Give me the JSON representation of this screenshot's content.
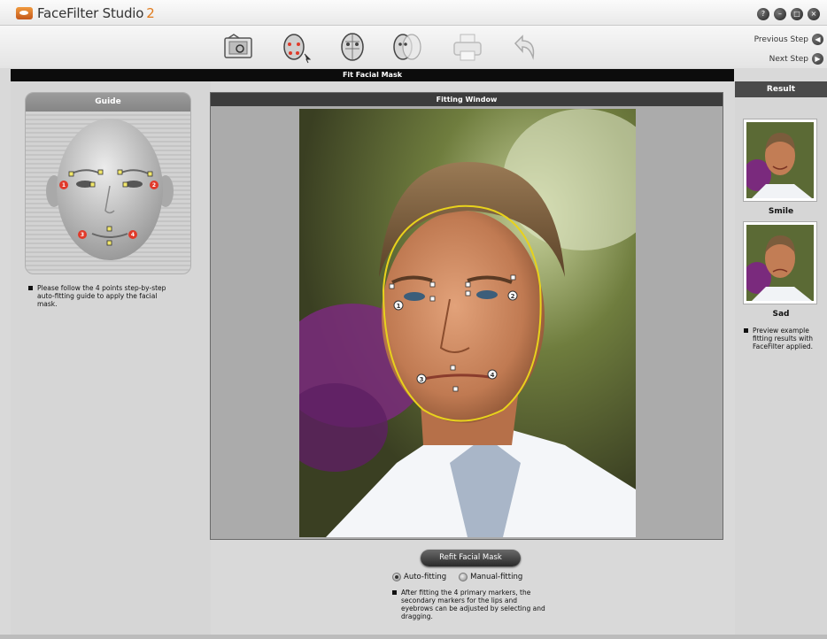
{
  "app": {
    "title": "FaceFilter Studio",
    "version": "2",
    "window_buttons": [
      "help-icon",
      "minimize-icon",
      "restore-icon",
      "close-icon"
    ]
  },
  "toolbar": {
    "steps": [
      "open-photo-icon",
      "fit-facial-mask-icon",
      "edit-face-icon",
      "compare-faces-icon",
      "print-icon",
      "undo-icon"
    ],
    "active_step": 1,
    "previous_step_label": "Previous Step",
    "next_step_label": "Next Step"
  },
  "section_title": "Fit Facial Mask",
  "guide": {
    "title": "Guide",
    "instruction": "Please follow the 4 points step-by-step auto-fitting guide to apply the facial mask.",
    "markers": [
      "1",
      "2",
      "3",
      "4"
    ]
  },
  "fitting_window": {
    "title": "Fitting Window",
    "markers": [
      "1",
      "2",
      "3",
      "4"
    ]
  },
  "controls": {
    "refit_button": "Refit Facial Mask",
    "auto_fitting_label": "Auto-fitting",
    "manual_fitting_label": "Manual-fitting",
    "selected_mode": "Auto-fitting",
    "note": "After fitting the 4 primary markers, the secondary markers for the lips and eyebrows can be adjusted by selecting and dragging."
  },
  "result": {
    "title": "Result",
    "previews": [
      {
        "label": "Smile"
      },
      {
        "label": "Sad"
      }
    ],
    "note": "Preview example fitting results with FaceFilter applied."
  },
  "colors": {
    "mask_outline": "#e8d21c",
    "marker_red": "#e03a2a",
    "marker_white": "#ffffff",
    "accent_orange": "#e07a1c"
  }
}
